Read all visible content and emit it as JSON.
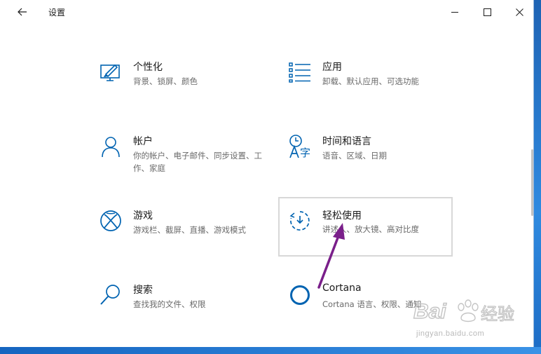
{
  "window": {
    "title": "设置",
    "back_icon": "back-arrow-icon",
    "controls": [
      "minimize-icon",
      "maximize-icon",
      "close-icon"
    ]
  },
  "categories": [
    {
      "name": "个性化",
      "desc": "背景、锁屏、颜色",
      "icon": "personalization-icon"
    },
    {
      "name": "应用",
      "desc": "卸载、默认应用、可选功能",
      "icon": "apps-icon"
    },
    {
      "name": "帐户",
      "desc": "你的帐户、电子邮件、同步设置、工作、家庭",
      "icon": "account-icon"
    },
    {
      "name": "时间和语言",
      "desc": "语音、区域、日期",
      "icon": "time-language-icon"
    },
    {
      "name": "游戏",
      "desc": "游戏栏、截屏、直播、游戏模式",
      "icon": "xbox-icon"
    },
    {
      "name": "轻松使用",
      "desc": "讲述人、放大镜、高对比度",
      "icon": "ease-of-access-icon",
      "highlighted": true
    },
    {
      "name": "搜索",
      "desc": "查找我的文件、权限",
      "icon": "search-icon"
    },
    {
      "name": "Cortana",
      "desc": "Cortana 语言、权限、通知",
      "icon": "cortana-icon"
    }
  ],
  "watermark": {
    "logo_text": "Bai 经验",
    "url_text": "jingyan.baidu.com"
  },
  "colors": {
    "accent": "#0063b1",
    "annotation_arrow": "#7a1f8a"
  }
}
